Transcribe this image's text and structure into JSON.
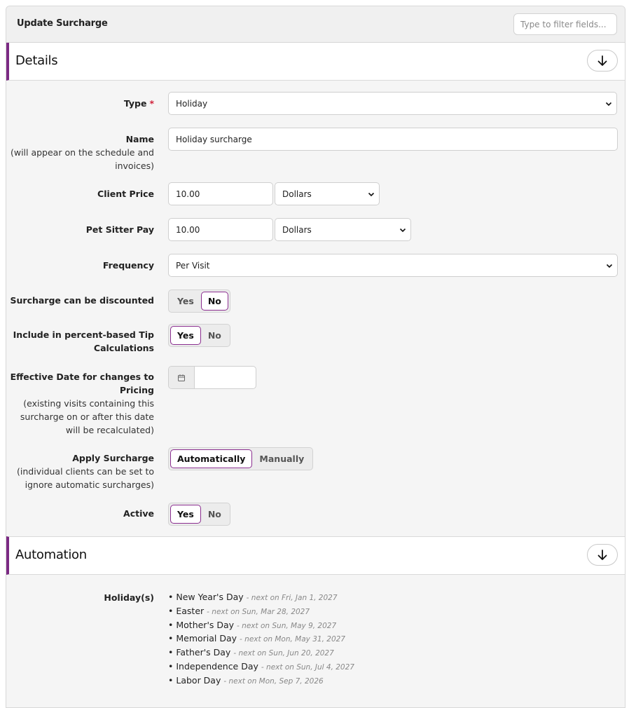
{
  "header": {
    "title": "Update Surcharge",
    "filter_placeholder": "Type to filter fields..."
  },
  "details": {
    "title": "Details",
    "type": {
      "label": "Type",
      "required_mark": "*",
      "value": "Holiday"
    },
    "name": {
      "label": "Name",
      "hint": "(will appear on the schedule and invoices)",
      "value": "Holiday surcharge"
    },
    "client_price": {
      "label": "Client Price",
      "value": "10.00",
      "unit": "Dollars"
    },
    "pet_sitter_pay": {
      "label": "Pet Sitter Pay",
      "value": "10.00",
      "unit": "Dollars"
    },
    "frequency": {
      "label": "Frequency",
      "value": "Per Visit"
    },
    "discountable": {
      "label": "Surcharge can be discounted",
      "options": [
        "Yes",
        "No"
      ],
      "selected": "No"
    },
    "tip_calc": {
      "label": "Include in percent-based Tip Calculations",
      "options": [
        "Yes",
        "No"
      ],
      "selected": "Yes"
    },
    "effective_date": {
      "label": "Effective Date for changes to Pricing",
      "hint": "(existing visits containing this surcharge on or after this date will be recalculated)",
      "value": ""
    },
    "apply": {
      "label": "Apply Surcharge",
      "hint": "(individual clients can be set to ignore automatic surcharges)",
      "options": [
        "Automatically",
        "Manually"
      ],
      "selected": "Automatically"
    },
    "active": {
      "label": "Active",
      "options": [
        "Yes",
        "No"
      ],
      "selected": "Yes"
    }
  },
  "automation": {
    "title": "Automation",
    "holidays_label": "Holiday(s)",
    "holidays": [
      {
        "name": "New Year's Day",
        "next": "- next on Fri, Jan 1, 2027"
      },
      {
        "name": "Easter",
        "next": "- next on Sun, Mar 28, 2027"
      },
      {
        "name": "Mother's Day",
        "next": "- next on Sun, May 9, 2027"
      },
      {
        "name": "Memorial Day",
        "next": "- next on Mon, May 31, 2027"
      },
      {
        "name": "Father's Day",
        "next": "- next on Sun, Jun 20, 2027"
      },
      {
        "name": "Independence Day",
        "next": "- next on Sun, Jul 4, 2027"
      },
      {
        "name": "Labor Day",
        "next": "- next on Mon, Sep 7, 2026"
      }
    ]
  },
  "colors": {
    "accent": "#7b2a83",
    "required": "#d0213a"
  }
}
